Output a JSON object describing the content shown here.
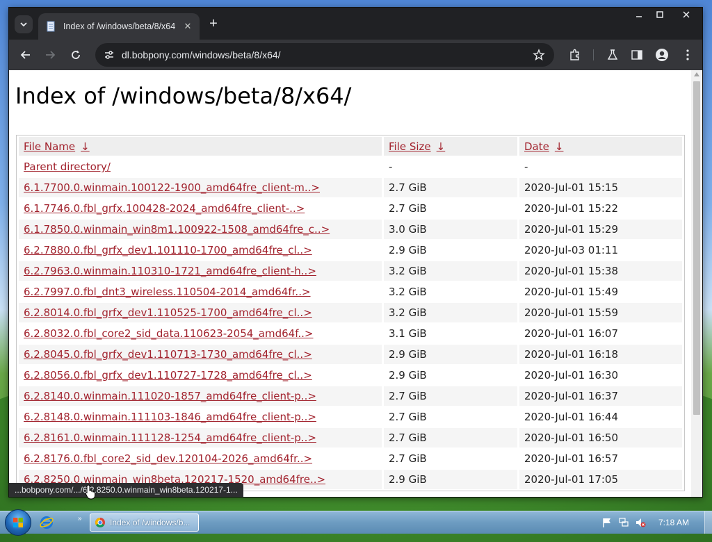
{
  "window": {
    "tab_title": "Index of /windows/beta/8/x64",
    "url": "dl.bobpony.com/windows/beta/8/x64/"
  },
  "page": {
    "title": "Index of /windows/beta/8/x64/",
    "columns": [
      {
        "label": "File Name",
        "arrow": "↓"
      },
      {
        "label": "File Size",
        "arrow": "↓"
      },
      {
        "label": "Date",
        "arrow": "↓"
      }
    ],
    "rows": [
      {
        "name": "Parent directory/",
        "size": "-",
        "date": "-"
      },
      {
        "name": "6.1.7700.0.winmain.100122-1900_amd64fre_client-m..>",
        "size": "2.7 GiB",
        "date": "2020-Jul-01 15:15"
      },
      {
        "name": "6.1.7746.0.fbl_grfx.100428-2024_amd64fre_client-..>",
        "size": "2.7 GiB",
        "date": "2020-Jul-01 15:22"
      },
      {
        "name": "6.1.7850.0.winmain_win8m1.100922-1508_amd64fre_c..>",
        "size": "3.0 GiB",
        "date": "2020-Jul-01 15:29"
      },
      {
        "name": "6.2.7880.0.fbl_grfx_dev1.101110-1700_amd64fre_cl..>",
        "size": "2.9 GiB",
        "date": "2020-Jul-03 01:11"
      },
      {
        "name": "6.2.7963.0.winmain.110310-1721_amd64fre_client-h..>",
        "size": "3.2 GiB",
        "date": "2020-Jul-01 15:38"
      },
      {
        "name": "6.2.7997.0.fbl_dnt3_wireless.110504-2014_amd64fr..>",
        "size": "3.2 GiB",
        "date": "2020-Jul-01 15:49"
      },
      {
        "name": "6.2.8014.0.fbl_grfx_dev1.110525-1700_amd64fre_cl..>",
        "size": "3.2 GiB",
        "date": "2020-Jul-01 15:59"
      },
      {
        "name": "6.2.8032.0.fbl_core2_sid_data.110623-2054_amd64f..>",
        "size": "3.1 GiB",
        "date": "2020-Jul-01 16:07"
      },
      {
        "name": "6.2.8045.0.fbl_grfx_dev1.110713-1730_amd64fre_cl..>",
        "size": "2.9 GiB",
        "date": "2020-Jul-01 16:18"
      },
      {
        "name": "6.2.8056.0.fbl_grfx_dev1.110727-1728_amd64fre_cl..>",
        "size": "2.9 GiB",
        "date": "2020-Jul-01 16:30"
      },
      {
        "name": "6.2.8140.0.winmain.111020-1857_amd64fre_client-p..>",
        "size": "2.7 GiB",
        "date": "2020-Jul-01 16:37"
      },
      {
        "name": "6.2.8148.0.winmain.111103-1846_amd64fre_client-p..>",
        "size": "2.7 GiB",
        "date": "2020-Jul-01 16:44"
      },
      {
        "name": "6.2.8161.0.winmain.111128-1254_amd64fre_client-p..>",
        "size": "2.7 GiB",
        "date": "2020-Jul-01 16:50"
      },
      {
        "name": "6.2.8176.0.fbl_core2_sid_dev.120104-2026_amd64fr..>",
        "size": "2.7 GiB",
        "date": "2020-Jul-01 16:57"
      },
      {
        "name": "6.2.8250.0.winmain_win8beta.120217-1520_amd64fre..>",
        "size": "2.9 GiB",
        "date": "2020-Jul-01 17:05"
      }
    ]
  },
  "status_bar": {
    "text": "...bobpony.com/.../6.2.8250.0.winmain_win8beta.120217-1..."
  },
  "taskbar": {
    "task_label": "Index of /windows/b...",
    "clock": "7:18 AM"
  },
  "colors": {
    "link": "#a2232e",
    "chrome_dark": "#202124",
    "chrome_toolbar": "#35363a"
  }
}
